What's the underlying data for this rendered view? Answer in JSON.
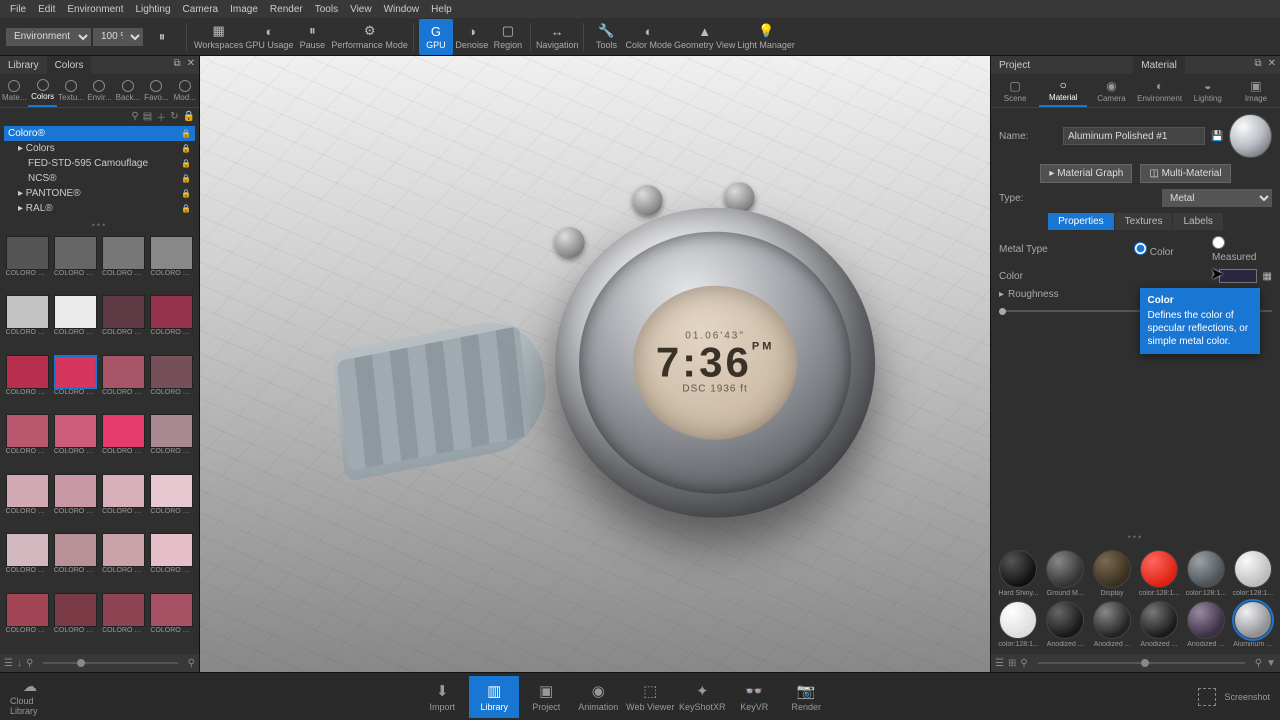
{
  "menu": [
    "File",
    "Edit",
    "Environment",
    "Lighting",
    "Camera",
    "Image",
    "Render",
    "Tools",
    "View",
    "Window",
    "Help"
  ],
  "toolbar": {
    "env_dropdown": "Environment",
    "zoom": "100 %",
    "buttons": [
      "Workspaces",
      "GPU Usage",
      "Pause",
      "Performance Mode",
      "GPU",
      "Denoise",
      "Region",
      "Navigation",
      "Tools",
      "Color Mode",
      "Geometry View",
      "Light Manager"
    ]
  },
  "left": {
    "tabs": [
      "Library",
      "Colors"
    ],
    "subtabs": [
      "Mate...",
      "Colors",
      "Textu...",
      "Envir...",
      "Back...",
      "Favo...",
      "Mod..."
    ],
    "tree": [
      "Coloro®",
      "Colors",
      "FED-STD-595 Camouflage",
      "NCS®",
      "PANTONE®",
      "RAL®"
    ],
    "swatch_label": "COLORO 00..."
  },
  "right": {
    "tabs": [
      "Project",
      "Material"
    ],
    "subtabs": [
      "Scene",
      "Material",
      "Camera",
      "Environment",
      "Lighting",
      "Image"
    ],
    "name_label": "Name:",
    "name_value": "Aluminum Polished #1",
    "graph_btn": "Material Graph",
    "multi_btn": "Multi-Material",
    "type_label": "Type:",
    "type_value": "Metal",
    "prop_tabs": [
      "Properties",
      "Textures",
      "Labels"
    ],
    "metal_type_label": "Metal Type",
    "radio_color": "Color",
    "radio_measured": "Measured",
    "color_label": "Color",
    "roughness_label": "Roughness",
    "tooltip_title": "Color",
    "tooltip_body": "Defines the color of specular reflections, or simple metal color.",
    "materials": [
      {
        "name": "Hard Shiny...",
        "bg": "radial-gradient(circle at 32% 28%,#555,#111 70%)"
      },
      {
        "name": "Ground M...",
        "bg": "radial-gradient(circle at 32% 28%,#888,#333 70%)"
      },
      {
        "name": "Display",
        "bg": "radial-gradient(circle at 32% 28%,#7a6a50,#3a3020 70%)"
      },
      {
        "name": "color:128:1...",
        "bg": "radial-gradient(circle at 32% 28%,#ff6860,#d21 70%)"
      },
      {
        "name": "color:128:1...",
        "bg": "radial-gradient(circle at 32% 28%,#9aa2a8,#4a5258 70%)"
      },
      {
        "name": "color:128:1...",
        "bg": "radial-gradient(circle at 32% 28%,#fafafa,#bcbcbc 70%)"
      },
      {
        "name": "color:128:1...",
        "bg": "radial-gradient(circle at 32% 28%,#fff,#ddd 70%)"
      },
      {
        "name": "Anodized ...",
        "bg": "radial-gradient(circle at 32% 28%,#666,#181818 70%)"
      },
      {
        "name": "Anodized ...",
        "bg": "radial-gradient(circle at 32% 28%,#888,#222 70%)"
      },
      {
        "name": "Anodized ...",
        "bg": "radial-gradient(circle at 32% 28%,#777,#1a1a1a 70%)"
      },
      {
        "name": "Anodized ...",
        "bg": "radial-gradient(circle at 32% 28%,#998aa0,#3a2f45 70%)"
      },
      {
        "name": "Aluminum ...",
        "bg": "radial-gradient(circle at 32% 28%,#f0f0f2,#8d8f95 70%)"
      }
    ]
  },
  "bottom": {
    "cloud": "Cloud Library",
    "buttons": [
      "Import",
      "Library",
      "Project",
      "Animation",
      "Web Viewer",
      "KeyShotXR",
      "KeyVR",
      "Render"
    ],
    "screenshot": "Screenshot"
  },
  "watch": {
    "line1": "01.06'43\"",
    "time": "7:36",
    "ampm": "PM",
    "line3": "DSC 1936 ft"
  },
  "swatch_colors": [
    "#555",
    "#666",
    "#777",
    "#888",
    "#c2c2c2",
    "#eaeaea",
    "#5d3a44",
    "#95324c",
    "#b82f4e",
    "#d4365e",
    "#a8556a",
    "#765058",
    "#b8576e",
    "#cd5c7a",
    "#e43a6e",
    "#aa8a92",
    "#d2aab4",
    "#c898a4",
    "#d8b0ba",
    "#e8c8d0",
    "#d4b8c0",
    "#b89098",
    "#caa2aa",
    "#e6c0c8",
    "#a24656",
    "#7a3a46",
    "#8e4452",
    "#a65264"
  ]
}
